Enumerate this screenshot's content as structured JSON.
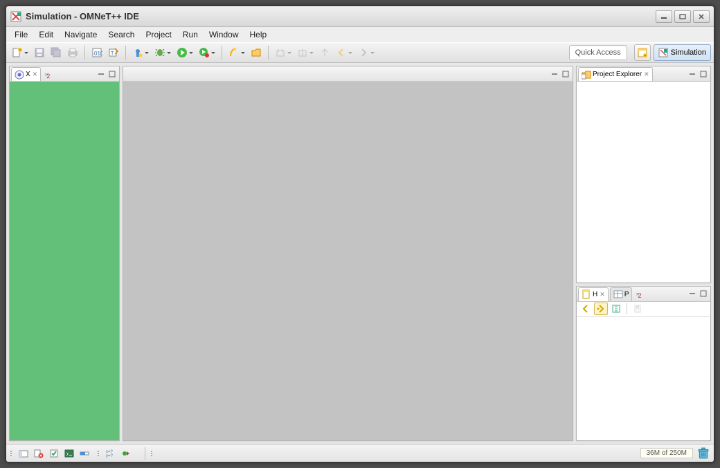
{
  "window": {
    "title": "Simulation - OMNeT++ IDE"
  },
  "menu": {
    "items": [
      "File",
      "Edit",
      "Navigate",
      "Search",
      "Project",
      "Run",
      "Window",
      "Help"
    ]
  },
  "toolbar": {
    "quick_access_label": "Quick Access",
    "perspective_button": "Simulation"
  },
  "left_view": {
    "tab_label": "X",
    "overflow_count": "2"
  },
  "right_top": {
    "tab_label": "Project Explorer"
  },
  "right_bottom": {
    "tab_h": "H",
    "tab_p": "P",
    "overflow_count": "2"
  },
  "editor": {},
  "status": {
    "heap": "36M of 250M"
  },
  "colors": {
    "left_panel_bg": "#62c078",
    "editor_bg": "#c3c3c3"
  }
}
